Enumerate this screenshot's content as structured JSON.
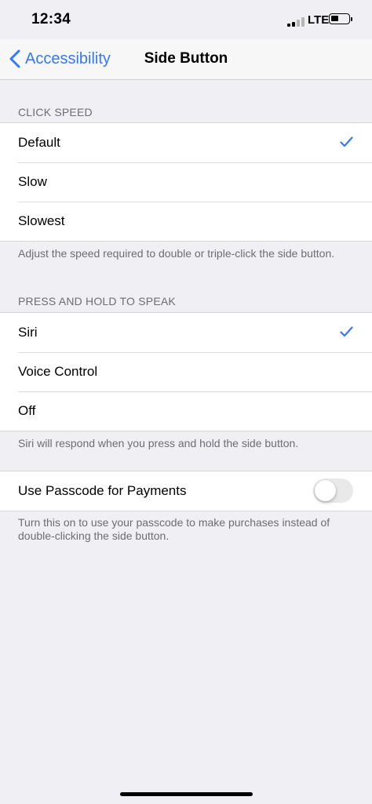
{
  "status_bar": {
    "time": "12:34",
    "carrier": "LTE",
    "icons": [
      "signal-icon",
      "battery-icon"
    ]
  },
  "nav": {
    "back_label": "Accessibility",
    "title": "Side Button",
    "back_icon": "chevron-left-icon"
  },
  "click_speed": {
    "header": "CLICK SPEED",
    "options": [
      {
        "label": "Default",
        "selected": true
      },
      {
        "label": "Slow",
        "selected": false
      },
      {
        "label": "Slowest",
        "selected": false
      }
    ],
    "footer": "Adjust the speed required to double or triple-click the side button."
  },
  "press_hold": {
    "header": "PRESS AND HOLD TO SPEAK",
    "options": [
      {
        "label": "Siri",
        "selected": true
      },
      {
        "label": "Voice Control",
        "selected": false
      },
      {
        "label": "Off",
        "selected": false
      }
    ],
    "footer": "Siri will respond when you press and hold the side button."
  },
  "passcode": {
    "label": "Use Passcode for Payments",
    "enabled": false,
    "footer": "Turn this on to use your passcode to make purchases instead of double-clicking the side button."
  },
  "colors": {
    "accent": "#3478f6",
    "background": "#efeff4",
    "secondary_text": "#6d6d72"
  }
}
